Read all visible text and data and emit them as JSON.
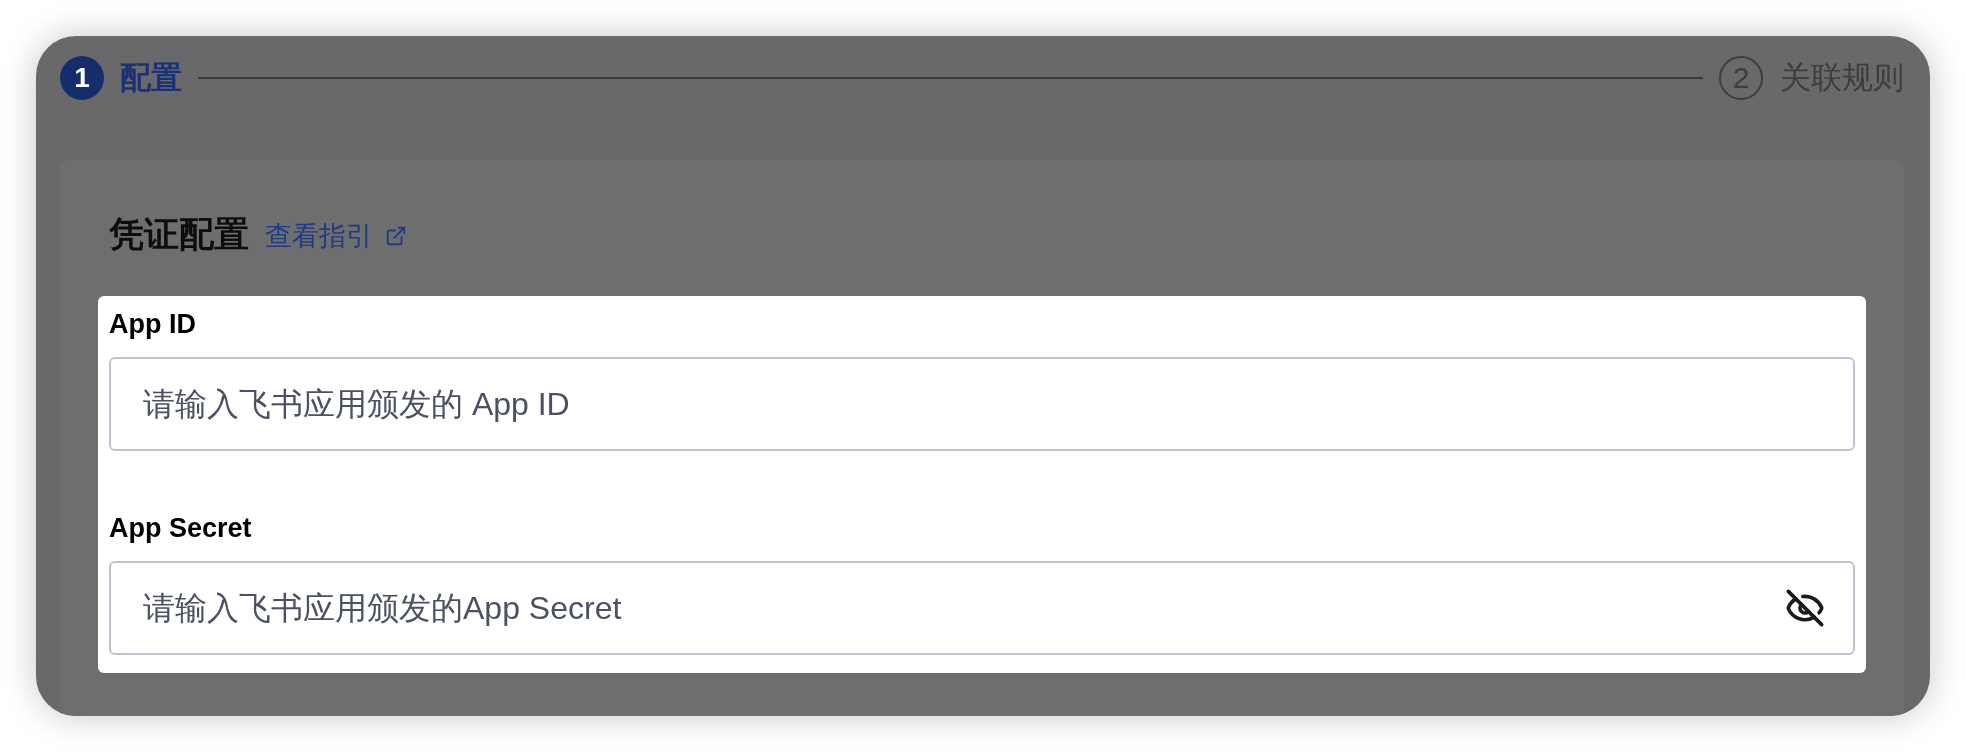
{
  "steps": [
    {
      "number": "1",
      "label": "配置",
      "selected": true
    },
    {
      "number": "2",
      "label": "关联规则",
      "selected": false
    }
  ],
  "section": {
    "title": "凭证配置",
    "link": "查看指引",
    "fields": [
      {
        "kind": "text",
        "label": "App ID",
        "placeholder": "请输入飞书应用颁发的 App ID"
      },
      {
        "kind": "password",
        "label": "App Secret",
        "placeholder": "请输入飞书应用颁发的App Secret",
        "revealed": false
      }
    ]
  }
}
